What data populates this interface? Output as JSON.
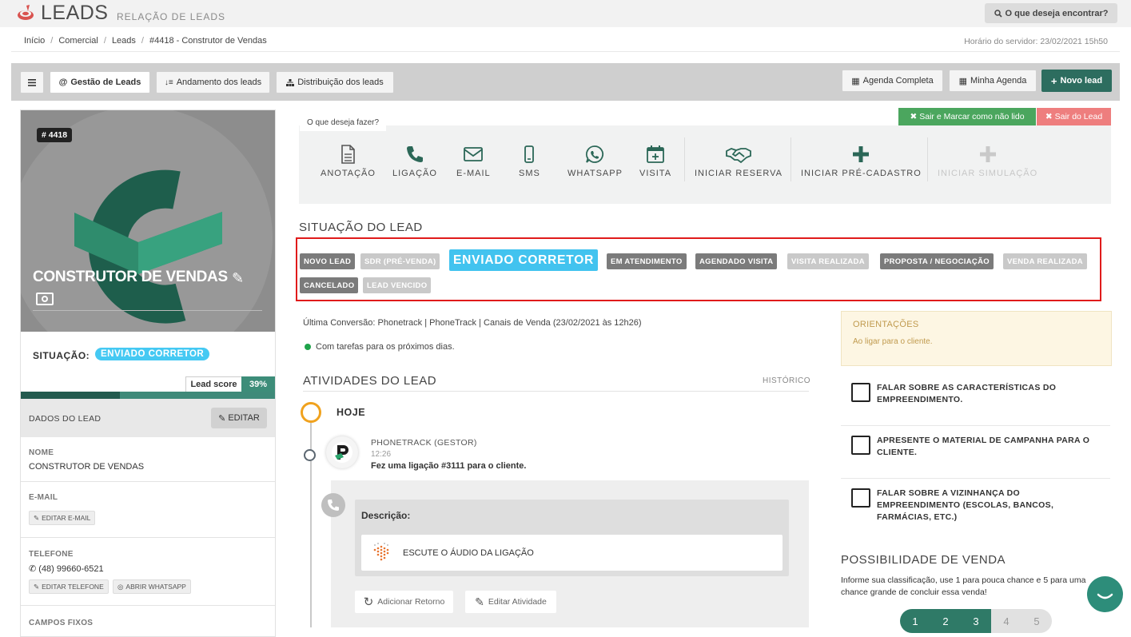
{
  "header": {
    "app_title": "LEADS",
    "app_subtitle": "RELAÇÃO DE LEADS",
    "search_label": "O que deseja encontrar?"
  },
  "breadcrumb": [
    "Início",
    "Comercial",
    "Leads",
    "#4418 - Construtor de Vendas"
  ],
  "server_time": "Horário do servidor: 23/02/2021 15h50",
  "toolbar": {
    "menu_icon": "hamburger-icon",
    "tabs": [
      {
        "label": "Gestão de Leads",
        "icon": "at-icon"
      },
      {
        "label": "Andamento dos leads",
        "icon": "sort-icon"
      },
      {
        "label": "Distribuição dos leads",
        "icon": "sitemap-icon"
      }
    ],
    "agenda_completa": "Agenda Completa",
    "minha_agenda": "Minha Agenda",
    "novo_lead": "Novo lead"
  },
  "lead": {
    "id_badge": "# 4418",
    "name": "CONSTRUTOR DE VENDAS",
    "situacao_label": "SITUAÇÃO:",
    "situacao_value": "ENVIADO CORRETOR",
    "lead_score_label": "Lead score",
    "lead_score_value": "39%",
    "lead_score": 0.39
  },
  "dados": {
    "title": "DADOS DO LEAD",
    "edit_label": "EDITAR",
    "nome_label": "NOME",
    "nome_value": "CONSTRUTOR DE VENDAS",
    "email_label": "E-MAIL",
    "editar_email": "EDITAR E-MAIL",
    "telefone_label": "TELEFONE",
    "telefone_value": "(48) 99660-6521",
    "editar_telefone": "EDITAR TELEFONE",
    "abrir_whatsapp": "ABRIR WHATSAPP",
    "campos_fixos": "CAMPOS FIXOS"
  },
  "actions": {
    "question": "O que deseja fazer?",
    "sair_marcar": "Sair e Marcar como não lido",
    "sair_lead": "Sair do Lead",
    "items": [
      {
        "label": "ANOTAÇÃO",
        "icon": "note-icon"
      },
      {
        "label": "LIGAÇÃO",
        "icon": "phone-icon"
      },
      {
        "label": "E-MAIL",
        "icon": "envelope-icon"
      },
      {
        "label": "SMS",
        "icon": "mobile-icon"
      },
      {
        "label": "WHATSAPP",
        "icon": "whatsapp-icon"
      },
      {
        "label": "VISITA",
        "icon": "calendar-plus-icon"
      },
      {
        "label": "INICIAR RESERVA",
        "icon": "handshake-icon"
      },
      {
        "label": "INICIAR PRÉ-CADASTRO",
        "icon": "plus-icon"
      },
      {
        "label": "INICIAR SIMULAÇÃO",
        "icon": "plus-icon"
      }
    ]
  },
  "situacao": {
    "title": "SITUAÇÃO DO LEAD",
    "stages": [
      {
        "label": "NOVO LEAD",
        "state": "done"
      },
      {
        "label": "SDR (PRÉ-VENDA)",
        "state": "skipped"
      },
      {
        "label": "ENVIADO CORRETOR",
        "state": "current"
      },
      {
        "label": "EM ATENDIMENTO",
        "state": "done"
      },
      {
        "label": "AGENDADO VISITA",
        "state": "done"
      },
      {
        "label": "VISITA REALIZADA",
        "state": "skipped"
      },
      {
        "label": "PROPOSTA / NEGOCIAÇÃO",
        "state": "done"
      },
      {
        "label": "VENDA REALIZADA",
        "state": "skipped"
      },
      {
        "label": "CANCELADO",
        "state": "done"
      },
      {
        "label": "LEAD VENCIDO",
        "state": "skipped"
      }
    ]
  },
  "conversao": "Última Conversão: Phonetrack | PhoneTrack | Canais de Venda (23/02/2021 às 12h26)",
  "tarefas": "Com tarefas para os próximos dias.",
  "atividades": {
    "title": "ATIVIDADES DO LEAD",
    "historico": "HISTÓRICO",
    "hoje": "HOJE",
    "item": {
      "author": "PHONETRACK (GESTOR)",
      "time": "12:26",
      "text": "Fez uma ligação #3111 para o cliente.",
      "desc_label": "Descrição:",
      "audio_label": "ESCUTE O ÁUDIO DA LIGAÇÃO",
      "adicionar_retorno": "Adicionar Retorno",
      "editar_atividade": "Editar Atividade"
    }
  },
  "orientacoes": {
    "title": "ORIENTAÇÕES",
    "text": "Ao ligar para o cliente."
  },
  "checklist": [
    "FALAR SOBRE AS CARACTERÍSTICAS DO EMPREENDIMENTO.",
    "APRESENTE O MATERIAL DE CAMPANHA PARA O CLIENTE.",
    "FALAR SOBRE A VIZINHANÇA DO EMPREENDIMENTO (ESCOLAS, BANCOS, FARMÁCIAS, ETC.)"
  ],
  "possibilidade": {
    "title": "POSSIBILIDADE DE VENDA",
    "text": "Informe sua classificação, use 1 para pouca chance e 5 para uma chance grande de concluir essa venda!",
    "options": [
      "1",
      "2",
      "3",
      "4",
      "5"
    ],
    "selected": 3
  },
  "colors": {
    "brand_green": "#2d6d5f",
    "current_stage": "#42c3ef",
    "stage_done": "#7b7b7b",
    "stage_skipped": "#c9c9c9",
    "highlight_frame": "#e01b1b"
  }
}
